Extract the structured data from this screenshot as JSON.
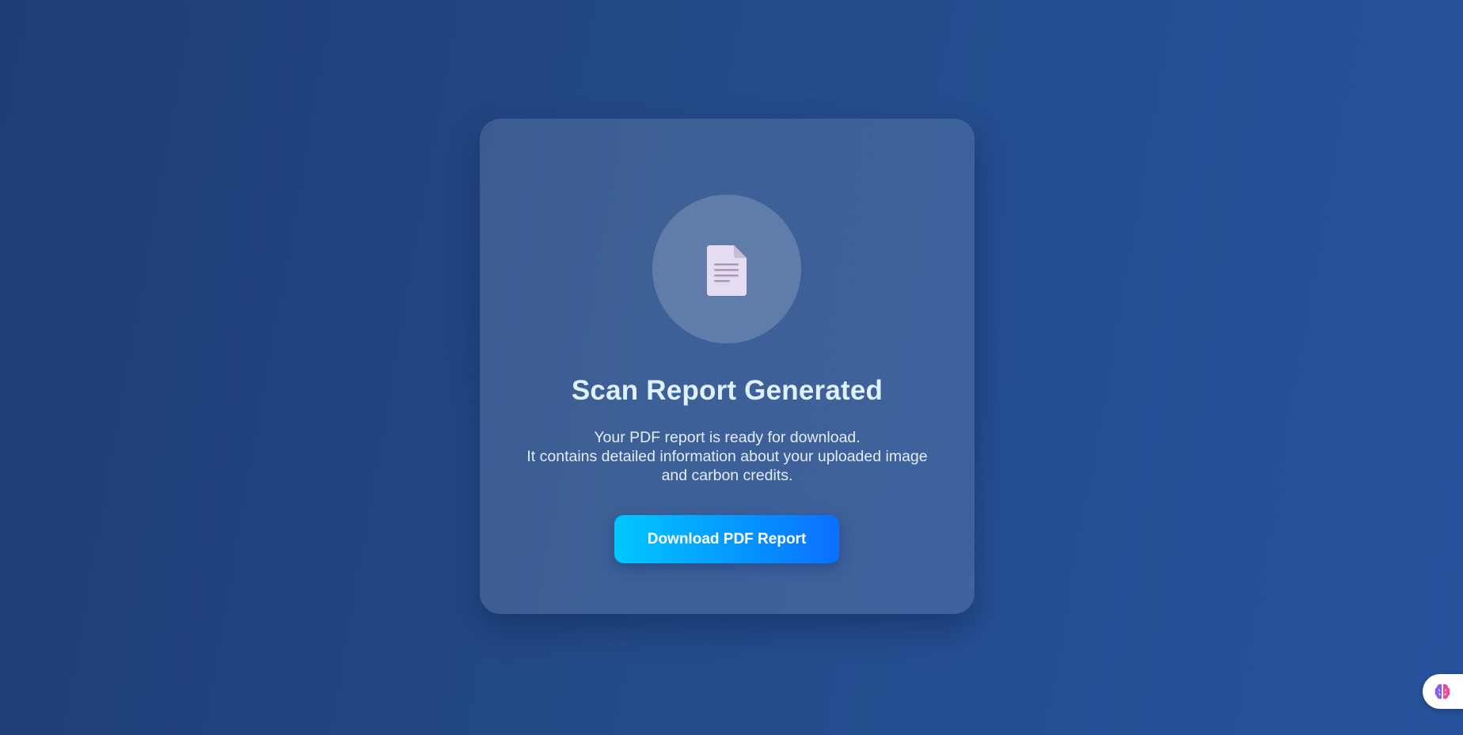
{
  "card": {
    "icon": "document-icon",
    "title": "Scan Report Generated",
    "description_lines": [
      "Your PDF report is ready for download.",
      "It contains detailed information about your uploaded image",
      "and carbon credits."
    ],
    "button_label": "Download PDF Report"
  },
  "widget": {
    "icon": "brain-icon"
  },
  "colors": {
    "background_start": "#1f3d74",
    "background_end": "#27539c",
    "title": "#dff1ff",
    "button_gradient_start": "#00c8ff",
    "button_gradient_end": "#0b6fff"
  }
}
